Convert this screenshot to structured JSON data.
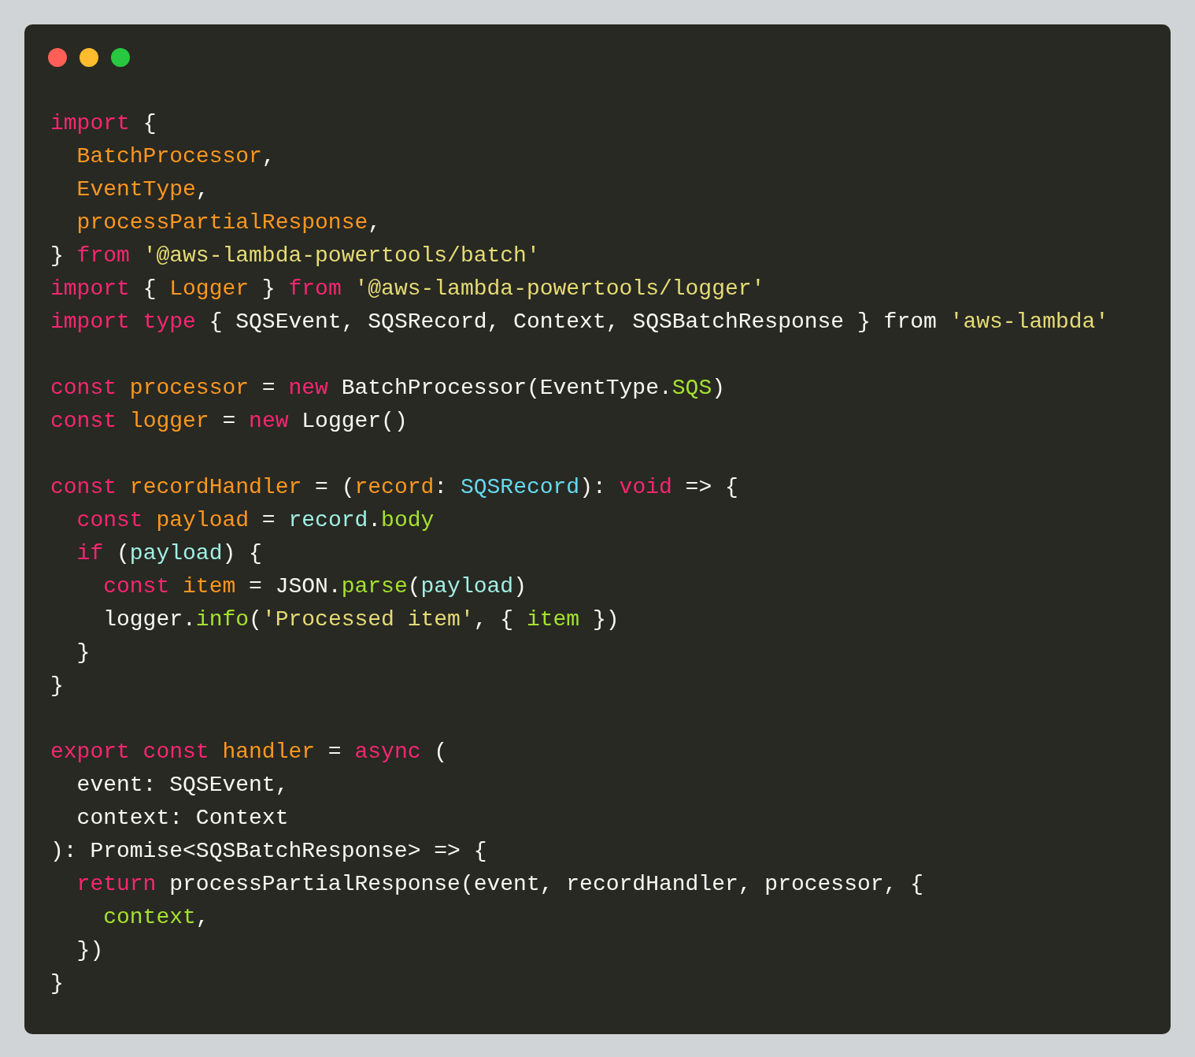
{
  "code_blocks": [
    {
      "lines": [
        {
          "tokens": [
            {
              "text": "import",
              "kind": "keyword"
            },
            {
              "text": " {",
              "kind": "plain"
            }
          ]
        },
        {
          "tokens": [
            {
              "text": "  BatchProcessor",
              "kind": "entity"
            },
            {
              "text": ",",
              "kind": "plain"
            }
          ]
        },
        {
          "tokens": [
            {
              "text": "  EventType",
              "kind": "entity"
            },
            {
              "text": ",",
              "kind": "plain"
            }
          ]
        },
        {
          "tokens": [
            {
              "text": "  processPartialResponse",
              "kind": "entity"
            },
            {
              "text": ",",
              "kind": "plain"
            }
          ]
        },
        {
          "tokens": [
            {
              "text": "} ",
              "kind": "plain"
            },
            {
              "text": "from ",
              "kind": "keyword"
            },
            {
              "text": "'@aws-lambda-powertools/batch'",
              "kind": "string"
            }
          ]
        },
        {
          "tokens": [
            {
              "text": "import ",
              "kind": "keyword"
            },
            {
              "text": "{ ",
              "kind": "plain"
            },
            {
              "text": "Logger",
              "kind": "entity"
            },
            {
              "text": " } ",
              "kind": "plain"
            },
            {
              "text": "from ",
              "kind": "keyword"
            },
            {
              "text": "'@aws-lambda-powertools/logger'",
              "kind": "string"
            }
          ]
        },
        {
          "tokens": [
            {
              "text": "import type ",
              "kind": "keyword"
            },
            {
              "text": "{ SQSEvent, SQSRecord, Context, SQSBatchResponse } from ",
              "kind": "plain"
            },
            {
              "text": "'aws-lambda'",
              "kind": "string"
            }
          ]
        }
      ]
    },
    {
      "lines": [
        {
          "tokens": [
            {
              "text": "const ",
              "kind": "keyword"
            },
            {
              "text": "processor",
              "kind": "entity"
            },
            {
              "text": " = ",
              "kind": "plain"
            },
            {
              "text": "new ",
              "kind": "keyword"
            },
            {
              "text": "BatchProcessor(EventType.",
              "kind": "plain"
            },
            {
              "text": "SQS",
              "kind": "function"
            },
            {
              "text": ")",
              "kind": "plain"
            }
          ]
        },
        {
          "tokens": [
            {
              "text": "const ",
              "kind": "keyword"
            },
            {
              "text": "logger",
              "kind": "entity"
            },
            {
              "text": " = ",
              "kind": "plain"
            },
            {
              "text": "new ",
              "kind": "keyword"
            },
            {
              "text": "Logger()",
              "kind": "plain"
            }
          ]
        }
      ]
    },
    {
      "lines": [
        {
          "tokens": [
            {
              "text": "const ",
              "kind": "keyword"
            },
            {
              "text": "recordHandler",
              "kind": "entity"
            },
            {
              "text": " = (",
              "kind": "plain"
            },
            {
              "text": "record",
              "kind": "entity"
            },
            {
              "text": ": ",
              "kind": "plain"
            },
            {
              "text": "SQSRecord",
              "kind": "type"
            },
            {
              "text": "): ",
              "kind": "plain"
            },
            {
              "text": "void ",
              "kind": "keyword"
            },
            {
              "text": "=> {",
              "kind": "plain"
            }
          ]
        },
        {
          "tokens": [
            {
              "text": "  const ",
              "kind": "keyword"
            },
            {
              "text": "payload",
              "kind": "entity"
            },
            {
              "text": " = ",
              "kind": "plain"
            },
            {
              "text": "record",
              "kind": "variable"
            },
            {
              "text": ".",
              "kind": "plain"
            },
            {
              "text": "body",
              "kind": "function"
            }
          ]
        },
        {
          "tokens": [
            {
              "text": "  if ",
              "kind": "keyword"
            },
            {
              "text": "(",
              "kind": "plain"
            },
            {
              "text": "payload",
              "kind": "variable"
            },
            {
              "text": ") {",
              "kind": "plain"
            }
          ]
        },
        {
          "tokens": [
            {
              "text": "    const ",
              "kind": "keyword"
            },
            {
              "text": "item",
              "kind": "entity"
            },
            {
              "text": " = JSON.",
              "kind": "plain"
            },
            {
              "text": "parse",
              "kind": "function"
            },
            {
              "text": "(",
              "kind": "plain"
            },
            {
              "text": "payload",
              "kind": "variable"
            },
            {
              "text": ")",
              "kind": "plain"
            }
          ]
        },
        {
          "tokens": [
            {
              "text": "    logger.",
              "kind": "plain"
            },
            {
              "text": "info",
              "kind": "function"
            },
            {
              "text": "(",
              "kind": "plain"
            },
            {
              "text": "'Processed item'",
              "kind": "string"
            },
            {
              "text": ", { ",
              "kind": "plain"
            },
            {
              "text": "item",
              "kind": "function"
            },
            {
              "text": " })",
              "kind": "plain"
            }
          ]
        },
        {
          "tokens": [
            {
              "text": "  }",
              "kind": "plain"
            }
          ]
        },
        {
          "tokens": [
            {
              "text": "}",
              "kind": "plain"
            }
          ]
        }
      ]
    },
    {
      "lines": [
        {
          "tokens": [
            {
              "text": "export const ",
              "kind": "keyword"
            },
            {
              "text": "handler",
              "kind": "entity"
            },
            {
              "text": " = ",
              "kind": "plain"
            },
            {
              "text": "async ",
              "kind": "keyword"
            },
            {
              "text": "(",
              "kind": "plain"
            }
          ]
        },
        {
          "tokens": [
            {
              "text": "  event: SQSEvent,",
              "kind": "plain"
            }
          ]
        },
        {
          "tokens": [
            {
              "text": "  context: Context",
              "kind": "plain"
            }
          ]
        },
        {
          "tokens": [
            {
              "text": "): Promise<SQSBatchResponse> => {",
              "kind": "plain"
            }
          ]
        },
        {
          "tokens": [
            {
              "text": "  return ",
              "kind": "keyword"
            },
            {
              "text": "processPartialResponse(event, recordHandler, processor, {",
              "kind": "plain"
            }
          ]
        },
        {
          "tokens": [
            {
              "text": "    context",
              "kind": "function"
            },
            {
              "text": ",",
              "kind": "plain"
            }
          ]
        },
        {
          "tokens": [
            {
              "text": "  })",
              "kind": "plain"
            }
          ]
        },
        {
          "tokens": [
            {
              "text": "}",
              "kind": "plain"
            }
          ]
        }
      ]
    }
  ]
}
